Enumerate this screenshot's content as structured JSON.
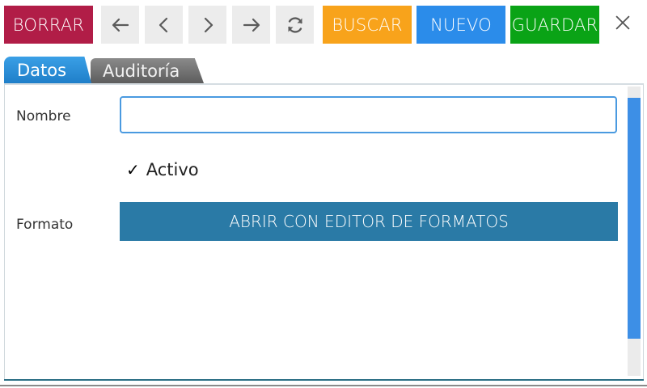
{
  "toolbar": {
    "borrar_label": "BORRAR",
    "buscar_label": "BUSCAR",
    "nuevo_label": "NUEVO",
    "guardar_label": "GUARDAR",
    "icons": [
      "arrow-left-icon",
      "chevron-left-icon",
      "chevron-right-icon",
      "arrow-right-icon",
      "refresh-icon",
      "close-icon"
    ]
  },
  "tabs": [
    {
      "label": "Datos",
      "active": true
    },
    {
      "label": "Auditoría",
      "active": false
    }
  ],
  "form": {
    "nombre_label": "Nombre",
    "nombre_value": "",
    "activo_label": "Activo",
    "activo_checked": true,
    "check_mark": "✓",
    "formato_label": "Formato",
    "editor_button_label": "ABRIR CON EDITOR DE FORMATOS"
  },
  "colors": {
    "borrar": "#b11d47",
    "buscar": "#f8a31b",
    "nuevo": "#2b8cea",
    "guardar": "#0aa316",
    "editor_button": "#2a7aa6",
    "tab_active": "#2b8cd8",
    "tab_inactive": "#6f6f6f"
  }
}
